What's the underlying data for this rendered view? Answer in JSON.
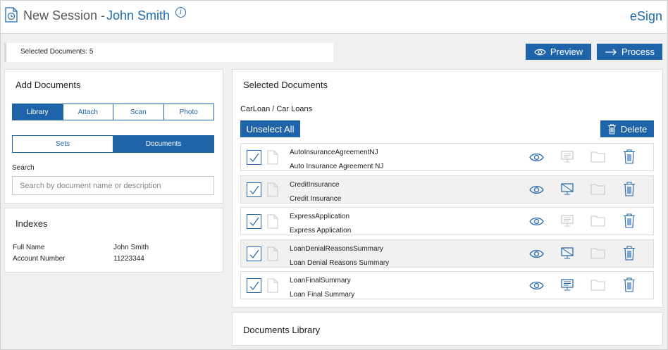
{
  "header": {
    "title": "New Session -",
    "user_name": "John Smith",
    "info_glyph": "i",
    "brand": "eSign"
  },
  "selection_bar": {
    "text": "Selected Documents: 5"
  },
  "actions": {
    "preview_label": "Preview",
    "process_label": "Process"
  },
  "add_documents": {
    "title": "Add Documents",
    "source_tabs": [
      {
        "label": "Library",
        "active": true
      },
      {
        "label": "Attach",
        "active": false
      },
      {
        "label": "Scan",
        "active": false
      },
      {
        "label": "Photo",
        "active": false
      }
    ],
    "type_tabs": [
      {
        "label": "Sets",
        "active": false
      },
      {
        "label": "Documents",
        "active": true
      }
    ],
    "search_label": "Search",
    "search_placeholder": "Search by document name or description"
  },
  "indexes": {
    "title": "Indexes",
    "rows": [
      {
        "key": "Full Name",
        "value": "John Smith"
      },
      {
        "key": "Account Number",
        "value": "11223344"
      }
    ]
  },
  "selected_documents": {
    "title": "Selected Documents",
    "path": "CarLoan / Car Loans",
    "unselect_label": "Unselect All",
    "delete_label": "Delete",
    "documents": [
      {
        "name": "AutoInsuranceAgreementNJ",
        "description": "Auto Insurance Agreement NJ",
        "checked": true,
        "monitor_state": "disabled"
      },
      {
        "name": "CreditInsurance",
        "description": "Credit Insurance",
        "checked": true,
        "monitor_state": "crossed"
      },
      {
        "name": "ExpressApplication",
        "description": "Express Application",
        "checked": true,
        "monitor_state": "disabled"
      },
      {
        "name": "LoanDenialReasonsSummary",
        "description": "Loan Denial Reasons Summary",
        "checked": true,
        "monitor_state": "crossed"
      },
      {
        "name": "LoanFinalSummary",
        "description": "Loan Final Summary",
        "checked": true,
        "monitor_state": "active"
      }
    ]
  },
  "documents_library": {
    "title": "Documents Library"
  },
  "colors": {
    "accent": "#1f64a8",
    "link": "#1f6aad",
    "disabled": "#c8c8c8"
  }
}
